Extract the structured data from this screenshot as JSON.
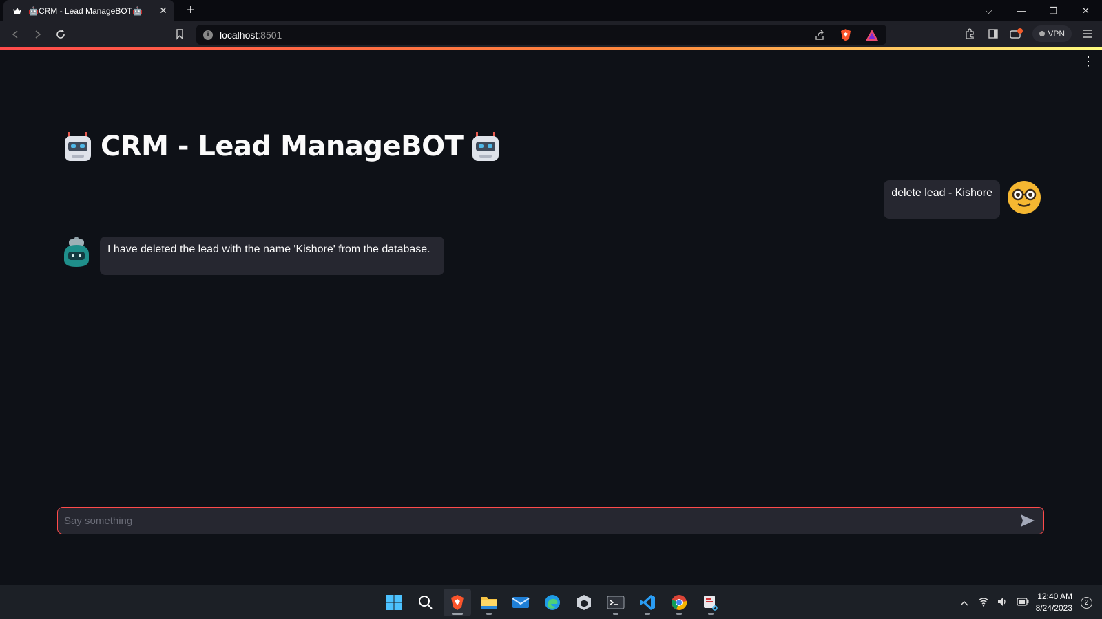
{
  "browser": {
    "tab_title": "🤖CRM - Lead ManageBOT🤖",
    "url_host": "localhost",
    "url_port": ":8501",
    "vpn_label": "VPN",
    "shields_badge": "1",
    "rewards_badge": "1"
  },
  "app": {
    "title": "CRM - Lead ManageBOT",
    "messages": [
      {
        "role": "user",
        "text": "delete lead - Kishore"
      },
      {
        "role": "assistant",
        "text": "I have deleted the lead with the name 'Kishore' from the database."
      }
    ],
    "input_placeholder": "Say something",
    "accent_color": "#ff4b4b"
  },
  "taskbar": {
    "time": "12:40 AM",
    "date": "8/24/2023",
    "notification_count": "2"
  }
}
